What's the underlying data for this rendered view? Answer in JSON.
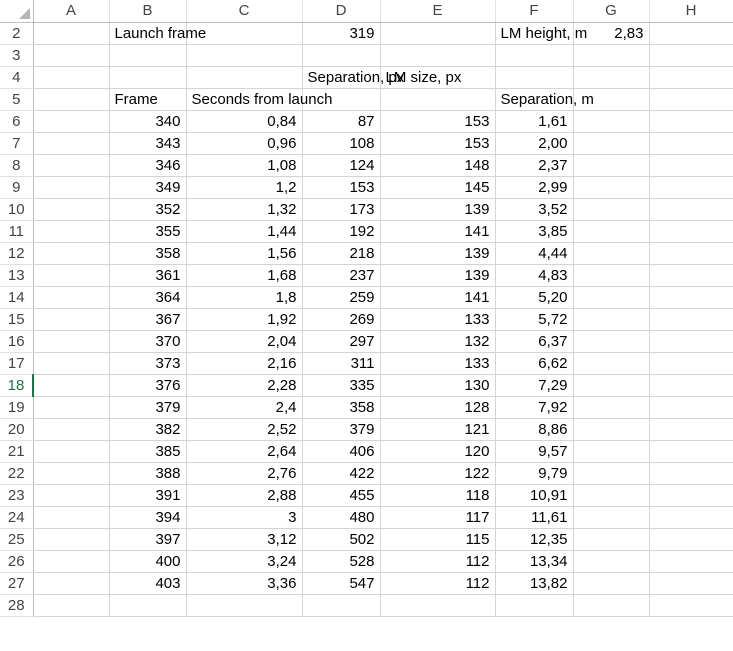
{
  "column_headers": [
    "A",
    "B",
    "C",
    "D",
    "E",
    "F",
    "G",
    "H"
  ],
  "active_row": "18",
  "row2": {
    "row": "2",
    "launch_label": "Launch frame",
    "launch_value": "319",
    "lm_label": "LM height, m",
    "lm_value": "2,83"
  },
  "row3": {
    "row": "3"
  },
  "row4": {
    "row": "4",
    "separation_px": "Separation, px",
    "lm_size_px": "LM size, px"
  },
  "row5": {
    "row": "5",
    "frame": "Frame",
    "seconds": "Seconds from launch",
    "separation_m": "Separation, m"
  },
  "data_rows": [
    {
      "row": "6",
      "frame": "340",
      "seconds": "0,84",
      "sep_px": "87",
      "lm_px": "153",
      "sep_m": "1,61"
    },
    {
      "row": "7",
      "frame": "343",
      "seconds": "0,96",
      "sep_px": "108",
      "lm_px": "153",
      "sep_m": "2,00"
    },
    {
      "row": "8",
      "frame": "346",
      "seconds": "1,08",
      "sep_px": "124",
      "lm_px": "148",
      "sep_m": "2,37"
    },
    {
      "row": "9",
      "frame": "349",
      "seconds": "1,2",
      "sep_px": "153",
      "lm_px": "145",
      "sep_m": "2,99"
    },
    {
      "row": "10",
      "frame": "352",
      "seconds": "1,32",
      "sep_px": "173",
      "lm_px": "139",
      "sep_m": "3,52"
    },
    {
      "row": "11",
      "frame": "355",
      "seconds": "1,44",
      "sep_px": "192",
      "lm_px": "141",
      "sep_m": "3,85"
    },
    {
      "row": "12",
      "frame": "358",
      "seconds": "1,56",
      "sep_px": "218",
      "lm_px": "139",
      "sep_m": "4,44"
    },
    {
      "row": "13",
      "frame": "361",
      "seconds": "1,68",
      "sep_px": "237",
      "lm_px": "139",
      "sep_m": "4,83"
    },
    {
      "row": "14",
      "frame": "364",
      "seconds": "1,8",
      "sep_px": "259",
      "lm_px": "141",
      "sep_m": "5,20"
    },
    {
      "row": "15",
      "frame": "367",
      "seconds": "1,92",
      "sep_px": "269",
      "lm_px": "133",
      "sep_m": "5,72"
    },
    {
      "row": "16",
      "frame": "370",
      "seconds": "2,04",
      "sep_px": "297",
      "lm_px": "132",
      "sep_m": "6,37"
    },
    {
      "row": "17",
      "frame": "373",
      "seconds": "2,16",
      "sep_px": "311",
      "lm_px": "133",
      "sep_m": "6,62"
    },
    {
      "row": "18",
      "frame": "376",
      "seconds": "2,28",
      "sep_px": "335",
      "lm_px": "130",
      "sep_m": "7,29"
    },
    {
      "row": "19",
      "frame": "379",
      "seconds": "2,4",
      "sep_px": "358",
      "lm_px": "128",
      "sep_m": "7,92"
    },
    {
      "row": "20",
      "frame": "382",
      "seconds": "2,52",
      "sep_px": "379",
      "lm_px": "121",
      "sep_m": "8,86"
    },
    {
      "row": "21",
      "frame": "385",
      "seconds": "2,64",
      "sep_px": "406",
      "lm_px": "120",
      "sep_m": "9,57"
    },
    {
      "row": "22",
      "frame": "388",
      "seconds": "2,76",
      "sep_px": "422",
      "lm_px": "122",
      "sep_m": "9,79"
    },
    {
      "row": "23",
      "frame": "391",
      "seconds": "2,88",
      "sep_px": "455",
      "lm_px": "118",
      "sep_m": "10,91"
    },
    {
      "row": "24",
      "frame": "394",
      "seconds": "3",
      "sep_px": "480",
      "lm_px": "117",
      "sep_m": "11,61"
    },
    {
      "row": "25",
      "frame": "397",
      "seconds": "3,12",
      "sep_px": "502",
      "lm_px": "115",
      "sep_m": "12,35"
    },
    {
      "row": "26",
      "frame": "400",
      "seconds": "3,24",
      "sep_px": "528",
      "lm_px": "112",
      "sep_m": "13,34"
    },
    {
      "row": "27",
      "frame": "403",
      "seconds": "3,36",
      "sep_px": "547",
      "lm_px": "112",
      "sep_m": "13,82"
    }
  ],
  "row28": {
    "row": "28"
  },
  "colors": {
    "gridline": "#d4d4d4",
    "header_text": "#444444",
    "active_row_accent": "#217346",
    "corner_triangle": "#b4b4b4"
  }
}
